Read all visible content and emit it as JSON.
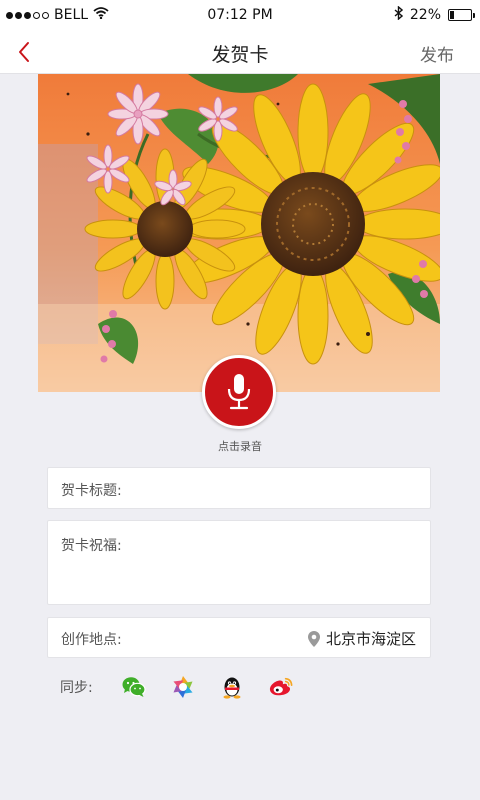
{
  "status_bar": {
    "carrier": "BELL",
    "time": "07:12 PM",
    "battery_percent": "22%",
    "battery_level": 0.22,
    "signal_icon": "signal-dots-icon",
    "wifi_icon": "wifi-icon",
    "bluetooth_icon": "bluetooth-icon"
  },
  "nav": {
    "title": "发贺卡",
    "publish": "发布",
    "back_icon": "chevron-left-icon",
    "accent_color": "#c91419"
  },
  "card": {
    "image": "sunflower-painting"
  },
  "record": {
    "label": "点击录音",
    "icon": "microphone-icon",
    "color": "#c91419"
  },
  "form": {
    "title_label": "贺卡标题:",
    "title_value": "",
    "blessing_label": "贺卡祝福:",
    "blessing_value": "",
    "location_label": "创作地点:",
    "location_value": "北京市海淀区",
    "location_icon": "location-pin-icon"
  },
  "sync": {
    "label": "同步:",
    "targets": [
      {
        "name": "wechat",
        "icon": "wechat-icon",
        "color": "#3fae29"
      },
      {
        "name": "moments",
        "icon": "moments-icon",
        "color": "#f5a623"
      },
      {
        "name": "qq",
        "icon": "qq-icon",
        "color": "#111111"
      },
      {
        "name": "weibo",
        "icon": "weibo-icon",
        "color": "#e6162d"
      }
    ]
  }
}
